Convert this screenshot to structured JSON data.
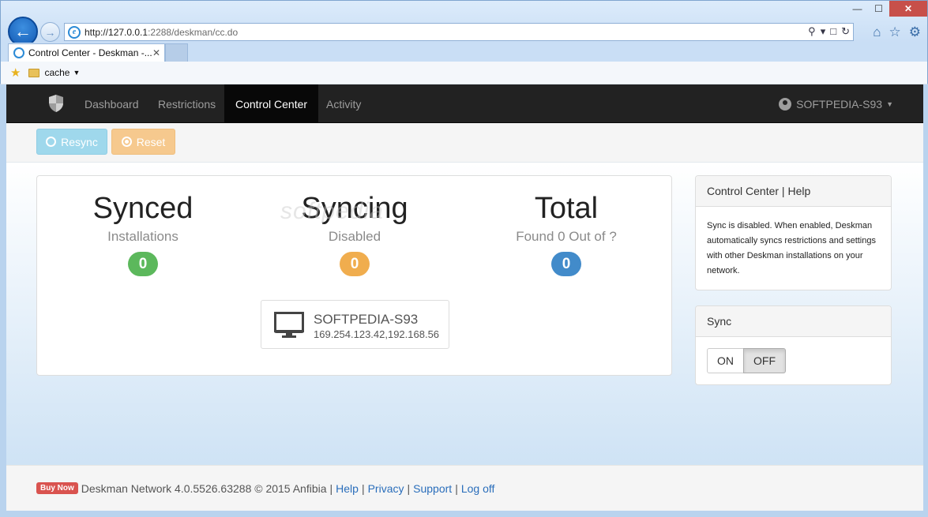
{
  "browser": {
    "url_prefix": "http://127.0.0.1",
    "url_rest": ":2288/deskman/cc.do",
    "tab_title": "Control Center - Deskman -...",
    "tab_close": "✕",
    "favorites_folder": "cache",
    "window_controls": {
      "minimize": "—",
      "maximize": "☐",
      "close": "✕"
    }
  },
  "navbar": {
    "items": [
      {
        "label": "Dashboard",
        "active": false
      },
      {
        "label": "Restrictions",
        "active": false
      },
      {
        "label": "Control Center",
        "active": true
      },
      {
        "label": "Activity",
        "active": false
      }
    ],
    "user": "SOFTPEDIA-S93"
  },
  "toolbar": {
    "resync_label": "Resync",
    "reset_label": "Reset"
  },
  "stats": [
    {
      "title": "Synced",
      "subtitle": "Installations",
      "count": "0",
      "color": "#5cb85c"
    },
    {
      "title": "Syncing",
      "subtitle": "Disabled",
      "count": "0",
      "color": "#f0ad4e"
    },
    {
      "title": "Total",
      "subtitle": "Found 0 Out of ?",
      "count": "0",
      "color": "#428bca"
    }
  ],
  "machine": {
    "name": "SOFTPEDIA-S93",
    "ip": "169.254.123.42,192.168.56"
  },
  "help_panel": {
    "title": "Control Center | Help",
    "text": "Sync is disabled. When enabled, Deskman automatically syncs restrictions and settings with other Deskman installations on your network."
  },
  "sync_panel": {
    "title": "Sync",
    "on_label": "ON",
    "off_label": "OFF",
    "selected": "OFF"
  },
  "footer": {
    "buy_now": "Buy Now",
    "copyright": "Deskman Network 4.0.5526.63288 © 2015 Anfibia",
    "links": [
      "Help",
      "Privacy",
      "Support",
      "Log off"
    ],
    "separator": "|"
  },
  "watermark": "softpedia"
}
